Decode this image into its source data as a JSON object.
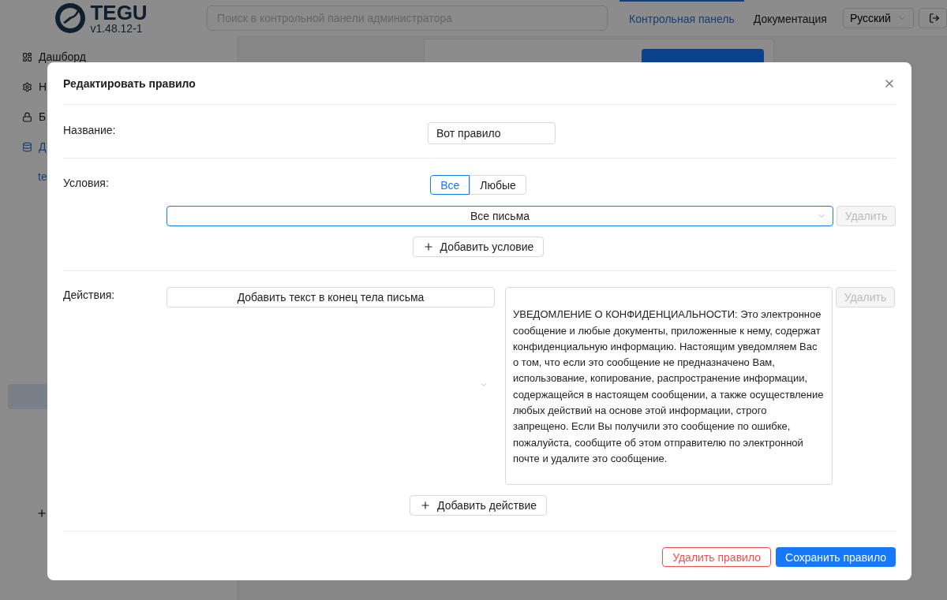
{
  "header": {
    "logo": {
      "name": "TEGU",
      "version": "v1.48.12-1"
    },
    "search": {
      "placeholder": "Поиск в контрольной панели администратора"
    },
    "nav": [
      {
        "label": "Контрольная панель",
        "selected": true
      },
      {
        "label": "Документация",
        "selected": false
      }
    ],
    "language": "Русский"
  },
  "sidebar": {
    "items": [
      {
        "label": "Дашборд",
        "kind": "dashboard",
        "selected": false
      },
      {
        "label": "Н",
        "kind": "settings",
        "selected": false
      },
      {
        "label": "Б",
        "kind": "lock",
        "selected": false
      },
      {
        "label": "Д",
        "kind": "database",
        "selected": true
      }
    ],
    "subitem": "te"
  },
  "dialog": {
    "title": "Редактировать правило",
    "name_label": "Название:",
    "name_value": "Вот правило",
    "conditions_label": "Условия:",
    "match": [
      {
        "label": "Все",
        "selected": true
      },
      {
        "label": "Любые",
        "selected": false
      }
    ],
    "conditions": [
      {
        "value": "Все письма",
        "delete": "Удалить",
        "disabled": true
      }
    ],
    "add_condition": "Добавить условие",
    "actions_label": "Действия:",
    "actions": [
      {
        "value": "Добавить текст в конец тела письма",
        "text": "\nУВЕДОМЛЕНИЕ О КОНФИДЕНЦИАЛЬНОСТИ: Это электронное сообщение и любые документы, приложенные к нему, содержат конфиденциальную информацию. Настоящим уведомляем Вас о том, что если это сообщение не предназначено Вам, использование, копирование, распространение информации, содержащейся в настоящем сообщении, а также осуществление любых действий на основе этой информации, строго запрещено. Если Вы получили это сообщение по ошибке, пожалуйста, сообщите об этом отправителю по электронной почте и удалите это сообщение.",
        "delete": "Удалить",
        "disabled": true
      }
    ],
    "add_action": "Добавить действие",
    "delete_rule": "Удалить правило",
    "save_rule": "Сохранить правило"
  }
}
